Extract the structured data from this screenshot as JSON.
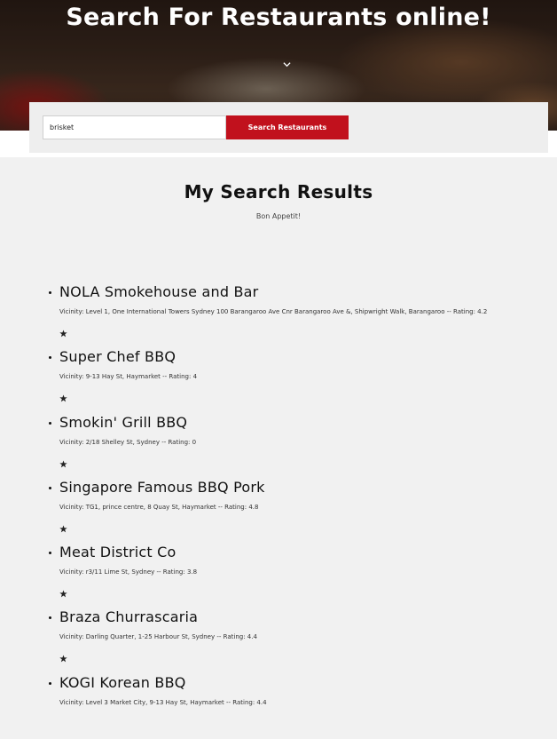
{
  "hero": {
    "title": "Search For Restaurants online!"
  },
  "search": {
    "value": "brisket",
    "button_label": "Search Restaurants"
  },
  "results": {
    "title": "My Search Results",
    "subtitle": "Bon Appetit!",
    "items": [
      {
        "name": "NOLA Smokehouse and Bar",
        "vicinity": "Vicinity: Level 1, One International Towers Sydney 100 Barangaroo Ave Cnr Barangaroo Ave &, Shipwright Walk, Barangaroo -- Rating: 4.2"
      },
      {
        "name": "Super Chef BBQ",
        "vicinity": "Vicinity: 9-13 Hay St, Haymarket -- Rating: 4"
      },
      {
        "name": "Smokin' Grill BBQ",
        "vicinity": "Vicinity: 2/18 Shelley St, Sydney -- Rating: 0"
      },
      {
        "name": "Singapore Famous BBQ Pork",
        "vicinity": "Vicinity: TG1, prince centre, 8 Quay St, Haymarket -- Rating: 4.8"
      },
      {
        "name": "Meat District Co",
        "vicinity": "Vicinity: r3/11 Lime St, Sydney -- Rating: 3.8"
      },
      {
        "name": "Braza Churrascaria",
        "vicinity": "Vicinity: Darling Quarter, 1-25 Harbour St, Sydney -- Rating: 4.4"
      },
      {
        "name": "KOGI Korean BBQ",
        "vicinity": "Vicinity: Level 3 Market City, 9-13 Hay St, Haymarket -- Rating: 4.4"
      }
    ]
  },
  "icons": {
    "chevron": "chevron-down-icon",
    "star": "star-icon"
  },
  "colors": {
    "accent": "#c1111d",
    "page_bg": "#f1f1f1"
  }
}
